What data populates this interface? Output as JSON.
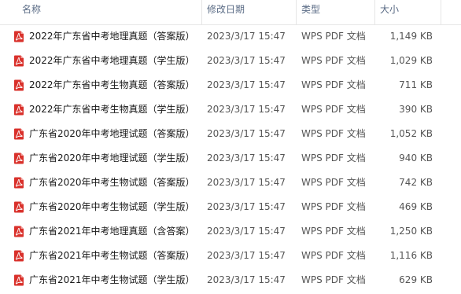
{
  "columns": {
    "name": "名称",
    "date": "修改日期",
    "type": "类型",
    "size": "大小"
  },
  "icon": "pdf-file-icon",
  "accent": "#d9312b",
  "files": [
    {
      "name": "2022年广东省中考地理真题（答案版）",
      "date": "2023/3/17 15:47",
      "type": "WPS PDF 文档",
      "size": "1,149 KB"
    },
    {
      "name": "2022年广东省中考地理真题（学生版）",
      "date": "2023/3/17 15:47",
      "type": "WPS PDF 文档",
      "size": "1,029 KB"
    },
    {
      "name": "2022年广东省中考生物真题（答案版）",
      "date": "2023/3/17 15:47",
      "type": "WPS PDF 文档",
      "size": "711 KB"
    },
    {
      "name": "2022年广东省中考生物真题（学生版）",
      "date": "2023/3/17 15:47",
      "type": "WPS PDF 文档",
      "size": "390 KB"
    },
    {
      "name": "广东省2020年中考地理试题（答案版）",
      "date": "2023/3/17 15:47",
      "type": "WPS PDF 文档",
      "size": "1,052 KB"
    },
    {
      "name": "广东省2020年中考地理试题（学生版）",
      "date": "2023/3/17 15:47",
      "type": "WPS PDF 文档",
      "size": "940 KB"
    },
    {
      "name": "广东省2020年中考生物试题（答案版）",
      "date": "2023/3/17 15:47",
      "type": "WPS PDF 文档",
      "size": "742 KB"
    },
    {
      "name": "广东省2020年中考生物试题（学生版）",
      "date": "2023/3/17 15:47",
      "type": "WPS PDF 文档",
      "size": "469 KB"
    },
    {
      "name": "广东省2021年中考地理真题（含答案）",
      "date": "2023/3/17 15:47",
      "type": "WPS PDF 文档",
      "size": "1,250 KB"
    },
    {
      "name": "广东省2021年中考生物试题（答案版）",
      "date": "2023/3/17 15:47",
      "type": "WPS PDF 文档",
      "size": "1,116 KB"
    },
    {
      "name": "广东省2021年中考生物试题（学生版）",
      "date": "2023/3/17 15:47",
      "type": "WPS PDF 文档",
      "size": "629 KB"
    }
  ]
}
